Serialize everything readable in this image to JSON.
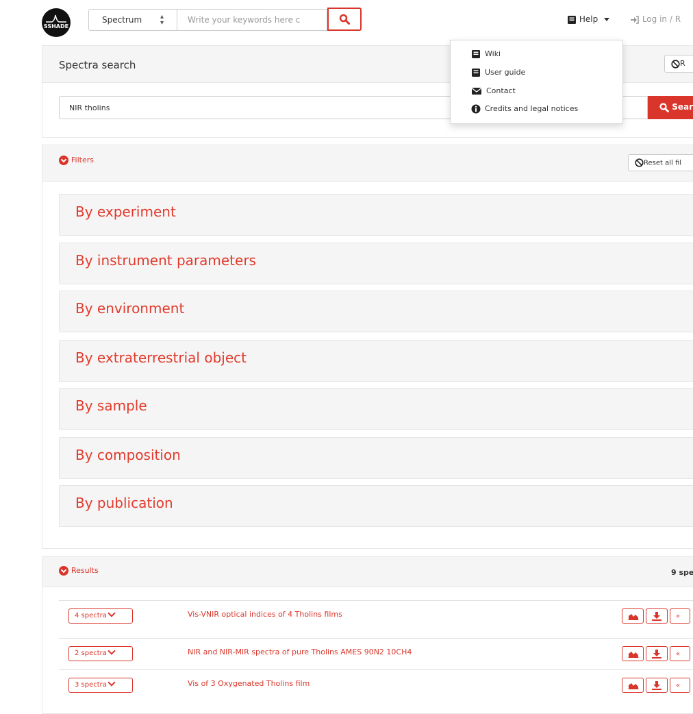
{
  "navbar": {
    "logo_text": "SSHADE",
    "type_select": "Spectrum",
    "keyword_placeholder": "Write your keywords here c",
    "help_label": "Help",
    "login_label": "Log in / R"
  },
  "help_menu": {
    "items": [
      "Wiki",
      "User guide",
      "Contact",
      "Credits and legal notices"
    ]
  },
  "spectra_search": {
    "title": "Spectra search",
    "reset_label": "R",
    "query_value": "NIR tholins",
    "search_button": "Sear"
  },
  "filters": {
    "title": "Filters",
    "reset_label": "Reset all fil",
    "groups": [
      "By experiment",
      "By instrument parameters",
      "By environment",
      "By extraterrestrial object",
      "By sample",
      "By composition",
      "By publication"
    ]
  },
  "results": {
    "title": "Results",
    "count_label": "9 spe",
    "rows": [
      {
        "spectra": "4 spectra",
        "title": "Vis-VNIR optical indices of 4 Tholins films"
      },
      {
        "spectra": "2 spectra",
        "title": "NIR and NIR-MIR spectra of pure Tholins AMES 90N2 10CH4"
      },
      {
        "spectra": "3 spectra",
        "title": "Vis of 3 Oxygenated Tholins film"
      }
    ],
    "more_label": "«"
  },
  "colors": {
    "accent": "#d9352a",
    "panel_bg": "#f5f5f5"
  }
}
